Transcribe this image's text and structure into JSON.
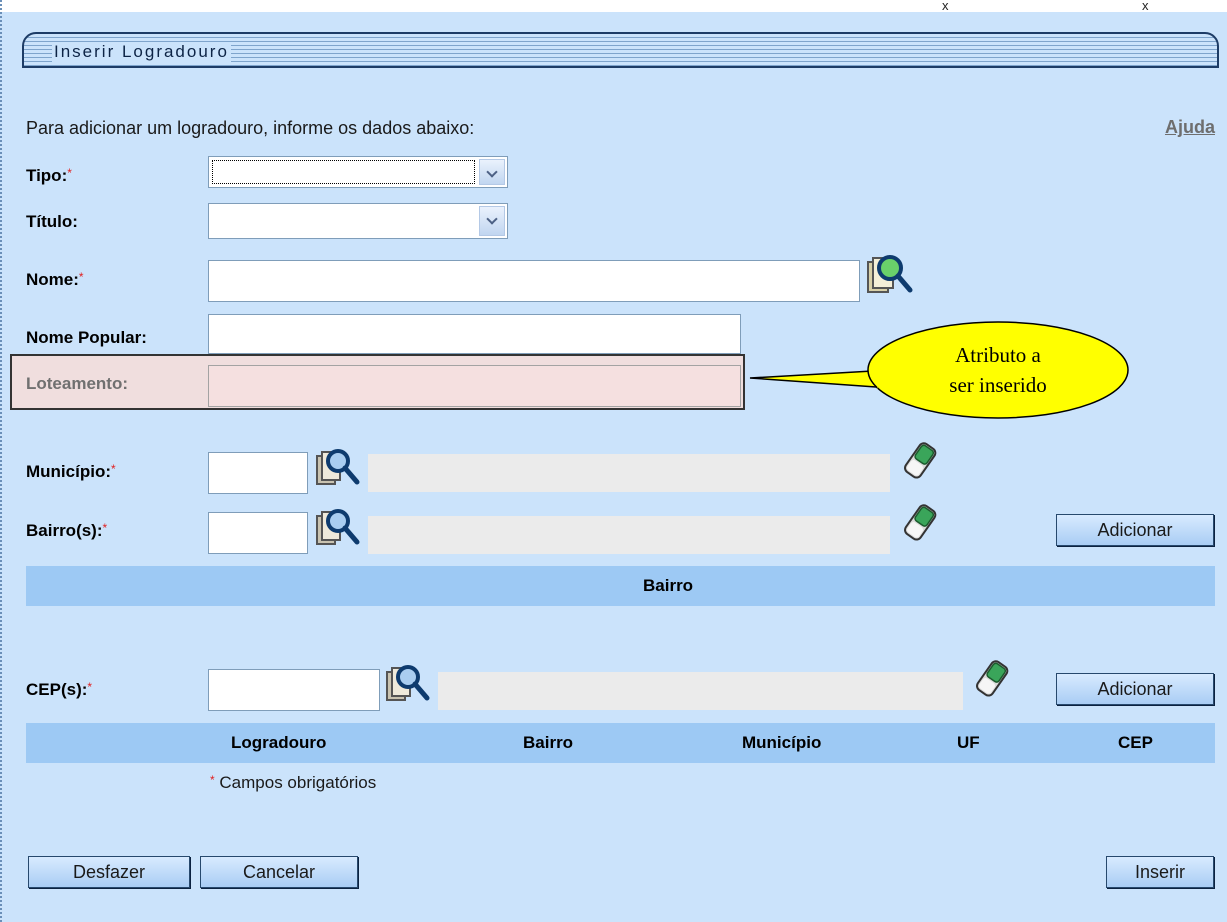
{
  "title": "Inserir Logradouro",
  "intro": "Para adicionar um logradouro, informe os dados abaixo:",
  "help_link": "Ajuda",
  "required_mark": "*",
  "fields": {
    "tipo": {
      "label": "Tipo:",
      "value": ""
    },
    "titulo": {
      "label": "Título:",
      "value": ""
    },
    "nome": {
      "label": "Nome:",
      "value": ""
    },
    "nome_popular": {
      "label": "Nome Popular:",
      "value": ""
    },
    "loteamento": {
      "label": "Loteamento:",
      "value": ""
    },
    "municipio": {
      "label": "Município:",
      "code": "",
      "description": ""
    },
    "bairros": {
      "label": "Bairro(s):",
      "code": "",
      "description": ""
    },
    "ceps": {
      "label": "CEP(s):",
      "code": "",
      "description": ""
    }
  },
  "bairro_table": {
    "header": "Bairro"
  },
  "cep_table": {
    "headers": [
      "Logradouro",
      "Bairro",
      "Município",
      "UF",
      "CEP"
    ]
  },
  "footnote": "Campos obrigatórios",
  "buttons": {
    "adicionar_bairro": "Adicionar",
    "adicionar_cep": "Adicionar",
    "desfazer": "Desfazer",
    "cancelar": "Cancelar",
    "inserir": "Inserir"
  },
  "callout": {
    "line1": "Atributo a",
    "line2": "ser inserido",
    "color": "#ffff00"
  },
  "top_marks": [
    "x",
    "x"
  ],
  "icons": {
    "search": "magnifier-search-icon",
    "clear": "eraser-icon"
  },
  "colors": {
    "background": "#cbe3fb",
    "header_band": "#9dc9f4",
    "button_border": "#27496d",
    "required": "#e02020",
    "highlight_field": "#f5e0e0"
  }
}
